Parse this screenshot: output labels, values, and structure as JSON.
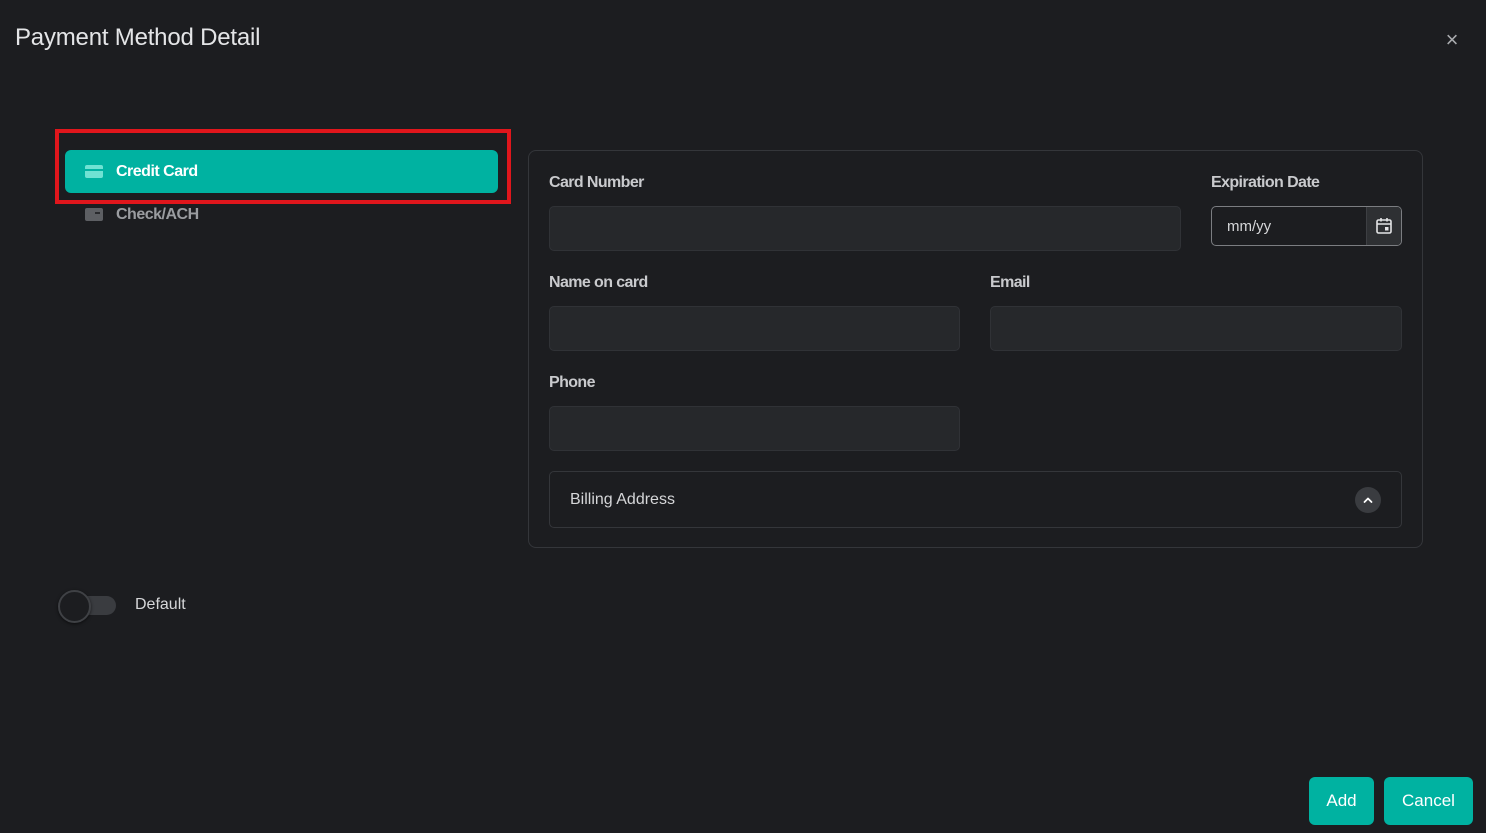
{
  "dialog": {
    "title": "Payment Method Detail",
    "close_icon": "×"
  },
  "methods": [
    {
      "label": "Credit Card",
      "icon": "credit-card-icon",
      "selected": true
    },
    {
      "label": "Check/ACH",
      "icon": "check-card-icon",
      "selected": false
    }
  ],
  "form": {
    "card_number": {
      "label": "Card Number",
      "value": "",
      "placeholder": ""
    },
    "expiration": {
      "label": "Expiration Date",
      "value": "",
      "placeholder": "mm/yy",
      "icon": "calendar-icon"
    },
    "name_on_card": {
      "label": "Name on card",
      "value": "",
      "placeholder": ""
    },
    "email": {
      "label": "Email",
      "value": "",
      "placeholder": ""
    },
    "phone": {
      "label": "Phone",
      "value": "",
      "placeholder": ""
    },
    "billing": {
      "label": "Billing Address",
      "icon": "chevron-up-icon",
      "expanded": false
    }
  },
  "default_toggle": {
    "label": "Default",
    "on": false
  },
  "footer": {
    "add_label": "Add",
    "cancel_label": "Cancel"
  },
  "colors": {
    "accent": "#00b2a1",
    "background": "#1c1d20",
    "highlight": "#e0161c"
  }
}
